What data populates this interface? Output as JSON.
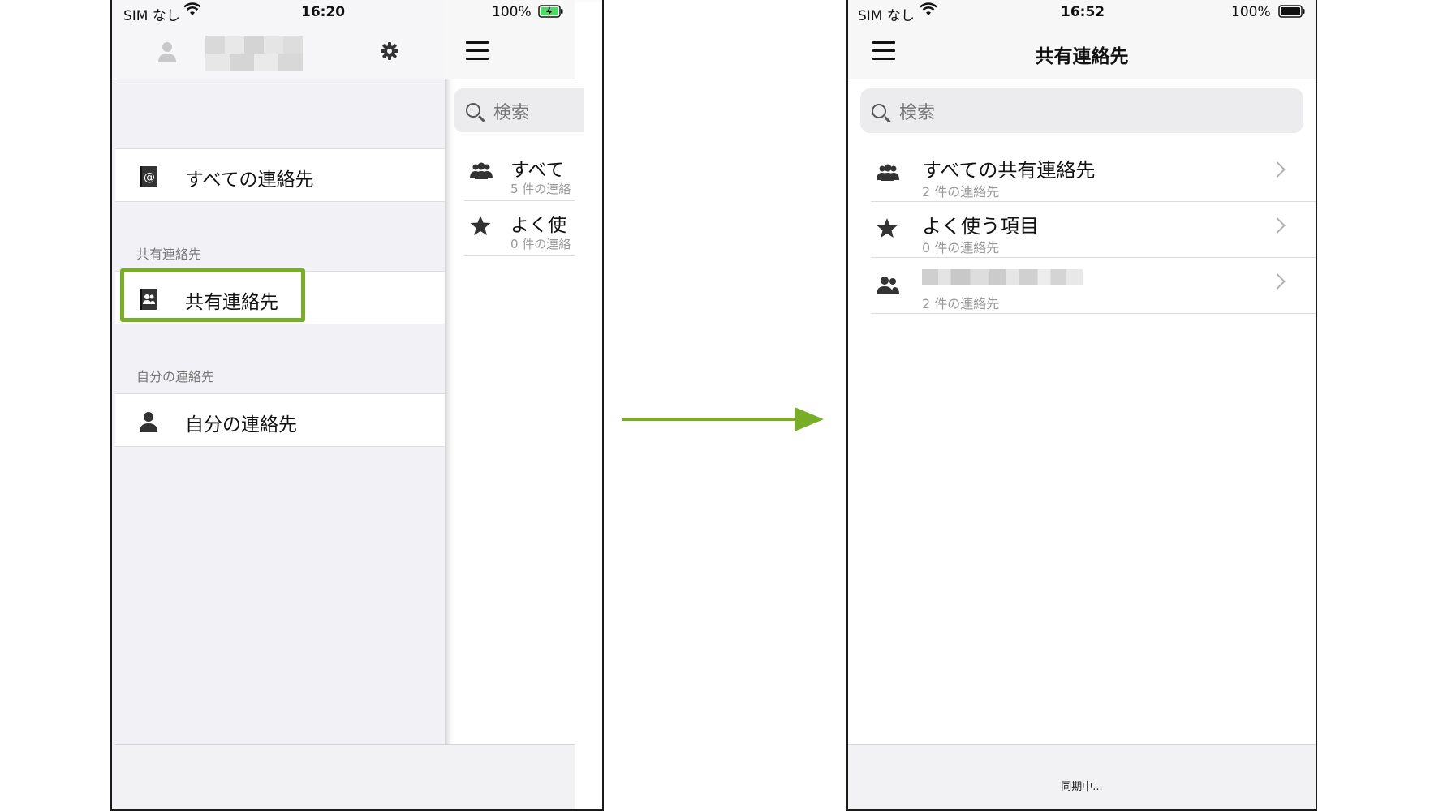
{
  "left_screen": {
    "status": {
      "carrier": "SIM なし",
      "time": "16:20",
      "battery": "100%"
    },
    "drawer": {
      "items": [
        {
          "label": "すべての連絡先",
          "icon": "address-book-at-icon"
        }
      ],
      "sections": [
        {
          "header": "共有連絡先",
          "item": {
            "label": "共有連絡先",
            "icon": "shared-contacts-book-icon",
            "highlighted": true
          }
        },
        {
          "header": "自分の連絡先",
          "item": {
            "label": "自分の連絡先",
            "icon": "person-icon"
          }
        }
      ]
    },
    "peek": {
      "search_placeholder": "検索",
      "rows": [
        {
          "title": "すべて",
          "subtitle": "5 件の連絡",
          "icon": "group-icon"
        },
        {
          "title": "よく使",
          "subtitle": "0 件の連絡",
          "icon": "star-icon"
        }
      ]
    }
  },
  "arrow_color": "#78ad28",
  "right_screen": {
    "status": {
      "carrier": "SIM なし",
      "time": "16:52",
      "battery": "100%"
    },
    "title": "共有連絡先",
    "search_placeholder": "検索",
    "rows": [
      {
        "title": "すべての共有連絡先",
        "subtitle": "2 件の連絡先",
        "icon": "group-icon"
      },
      {
        "title": "よく使う項目",
        "subtitle": "0 件の連絡先",
        "icon": "star-icon"
      },
      {
        "title": "",
        "subtitle": "2 件の連絡先",
        "icon": "two-people-icon",
        "title_blurred": true
      }
    ],
    "footer_status": "同期中..."
  }
}
